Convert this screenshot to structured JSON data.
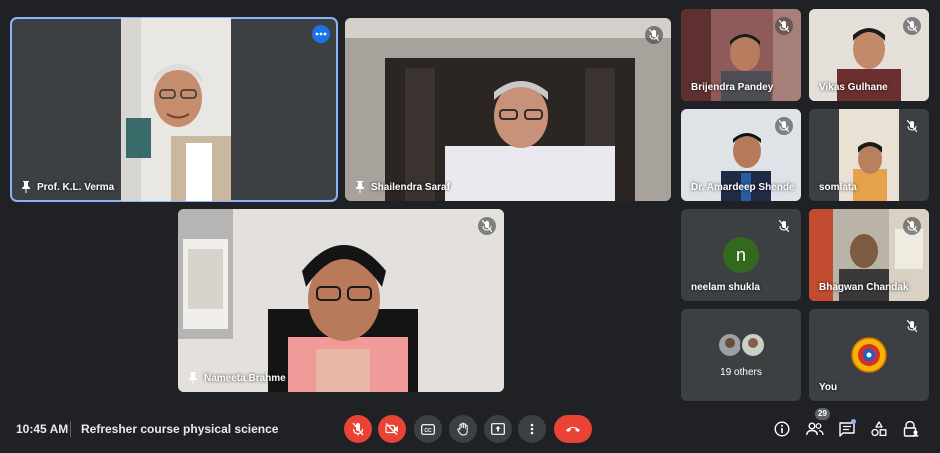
{
  "participants_main": [
    {
      "name": "Prof. K.L. Verma",
      "active": true
    },
    {
      "name": "Shailendra Saraf"
    },
    {
      "name": "Nameeta Brahme"
    }
  ],
  "participants_side": [
    {
      "name": "Brijendra Pandey"
    },
    {
      "name": "Vikas Gulhane"
    },
    {
      "name": "Dr. Amardeep Shende"
    },
    {
      "name": "somlata"
    },
    {
      "name": "neelam shukla",
      "initial": "n",
      "avatar_color": "#33691e"
    },
    {
      "name": "Bhagwan Chandak"
    }
  ],
  "others": {
    "label": "19 others"
  },
  "self": {
    "label": "You"
  },
  "bottom_bar": {
    "time": "10:45 AM",
    "meeting_title": "Refresher course physical science",
    "people_count": "29"
  },
  "icons": {
    "mic": "mic-off-icon",
    "camera": "camera-off-icon",
    "captions": "captions-icon",
    "raise_hand": "hand-icon",
    "present": "present-screen-icon",
    "more": "more-vert-icon",
    "end_call": "end-call-icon",
    "info": "info-icon",
    "people": "people-icon",
    "chat": "chat-icon",
    "activities": "activities-icon",
    "host_controls": "lock-person-icon"
  },
  "colors": {
    "background": "#202124",
    "tile": "#3c4043",
    "danger": "#ea4335",
    "accent": "#8ab4f8"
  }
}
